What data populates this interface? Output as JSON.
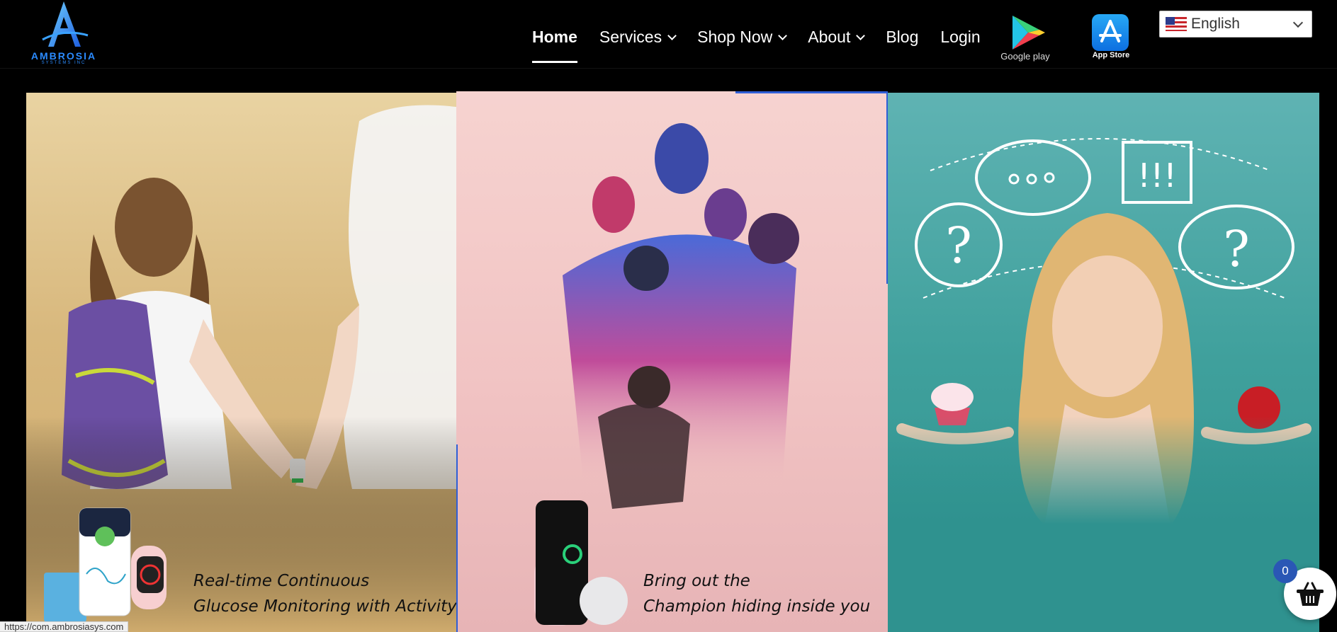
{
  "header": {
    "logo": {
      "name": "AMBROSIA",
      "sub": "SYSTEMS INC"
    },
    "nav": [
      {
        "label": "Home",
        "active": true,
        "dropdown": false
      },
      {
        "label": "Services",
        "active": false,
        "dropdown": true
      },
      {
        "label": "Shop Now",
        "active": false,
        "dropdown": true
      },
      {
        "label": "About",
        "active": false,
        "dropdown": true
      },
      {
        "label": "Blog",
        "active": false,
        "dropdown": false
      },
      {
        "label": "Login",
        "active": false,
        "dropdown": false
      }
    ],
    "stores": {
      "google_label": "Google play",
      "apple_label": "App Store"
    },
    "language": {
      "selected": "English",
      "flag_icon": "us-flag-icon"
    }
  },
  "slides": [
    {
      "caption_line1": "Real-time Continuous",
      "caption_line2": "Glucose Monitoring with Activity"
    },
    {
      "caption_line1": "Bring out the",
      "caption_line2": "Champion hiding inside you"
    },
    {
      "caption_line1": "",
      "caption_line2": ""
    }
  ],
  "cart": {
    "count": "0"
  },
  "status_bar": {
    "url": "https://com.ambrosiasys.com"
  },
  "colors": {
    "accent": "#2f5fd6",
    "badge": "#2a57b5"
  }
}
